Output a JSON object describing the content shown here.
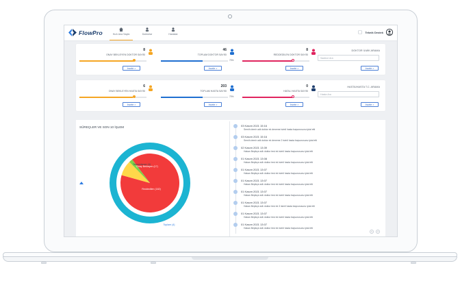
{
  "header": {
    "brand": "FlowPro",
    "nav": [
      {
        "label": "Hızlı Ana Sayfa",
        "icon": "home-icon"
      },
      {
        "label": "Doktorlar",
        "icon": "doctor-icon"
      },
      {
        "label": "Hastalar",
        "icon": "patient-icon"
      }
    ],
    "user_name": "Teknik Destek"
  },
  "doctor_stats": [
    {
      "value": "8",
      "label": "ONAY BEKLEYEN DOKTOR SAYISI",
      "color": "#f5a623",
      "percent_text": "",
      "fill": 0.82,
      "button": "İncele >"
    },
    {
      "value": "46",
      "label": "TOPLAM DOKTOR SAYISI",
      "color": "#1f6fd0",
      "percent_text": "70%",
      "fill": 0.62,
      "button": "İncele >"
    },
    {
      "value": "8",
      "label": "REDDEDİLEN DOKTOR SAYISI",
      "color": "#e0245e",
      "percent_text": "",
      "fill": 0.74,
      "button": "İncele >"
    }
  ],
  "doctor_search": {
    "title": "DOKTOR İLMİK ARAMA",
    "placeholder": "Sadece Ara",
    "button": "İncele >"
  },
  "patient_stats": [
    {
      "value": "6",
      "label": "ONAY BEKLEYEN HASTA SAYISI",
      "color": "#f5a623",
      "percent_text": "",
      "fill": 0.8,
      "button": "İncele >"
    },
    {
      "value": "203",
      "label": "TOPLAM HASTA SAYISI",
      "color": "#1f6fd0",
      "percent_text": "70%",
      "fill": 0.62,
      "button": "İncele >"
    },
    {
      "value": "0",
      "label": "HATALI HASTA SAYISI",
      "color": "#e0245e",
      "percent_text": "",
      "fill": 0.74,
      "button": "İncele >"
    }
  ],
  "patient_search": {
    "title": "HASTA/HASTA T.C. ARAMA",
    "placeholder": "Hasta Ara",
    "button": "İncele >"
  },
  "process_panel": {
    "title": "SÜREÇLER VE SON 10 İŞLEM"
  },
  "chart_data": {
    "type": "pie",
    "slices": [
      {
        "label": "Reddedilen (182)",
        "value": 182,
        "color": "#f23b3b"
      },
      {
        "label": "Onay Bekleyen (17)",
        "value": 17,
        "color": "#ffd84a"
      },
      {
        "label": "Tamamlanan (4)",
        "value": 4,
        "color": "#7ed24a"
      }
    ],
    "outer_ring": {
      "label": "Toplam (4)",
      "color": "#1cb4d2"
    }
  },
  "timeline": [
    {
      "date": "03 Kasım 2021 15:16",
      "desc": "Semih demir adlı doktor ek deneme isimli hasta başvurusunu iptal etti"
    },
    {
      "date": "03 Kasım 2021 15:16",
      "desc": "Semih demir adlı doktor ek deneme 2 isimli hasta başvurusunu iptal etti"
    },
    {
      "date": "02 Kasım 2021 13:39",
      "desc": "Hakan Beşikçe adlı doktor test ek isimli hasta başvurusunu iptal etti"
    },
    {
      "date": "01 Kasım 2021 13:08",
      "desc": "Hakan Beşikçe adlı doktor test ek isimli hasta başvurusunu iptal etti"
    },
    {
      "date": "01 Kasım 2021 13:07",
      "desc": "Hakan Beşikçe adlı doktor test ek isimli hasta başvurusunu iptal etti"
    },
    {
      "date": "01 Kasım 2021 13:07",
      "desc": "Hakan Beşikçe adlı doktor test ek isimli hasta başvurusunu iptal etti"
    },
    {
      "date": "01 Kasım 2021 13:07",
      "desc": "Hakan Beşikçe adlı doktor test ek isimli hasta başvurusunu iptal etti"
    },
    {
      "date": "01 Kasım 2021 13:07",
      "desc": "Hakan Beşikçe adlı doktor test ek 3 isimli hasta başvurusunu iptal etti"
    },
    {
      "date": "01 Kasım 2021 13:07",
      "desc": "Hakan Beşikçe adlı doktor test ek isimli hasta başvurusunu iptal etti"
    },
    {
      "date": "01 Kasım 2021 13:07",
      "desc": "Hakan Beşikçe adlı doktor test ek isimli hasta başvurusunu iptal etti"
    }
  ],
  "pager": [
    "<",
    ">"
  ]
}
